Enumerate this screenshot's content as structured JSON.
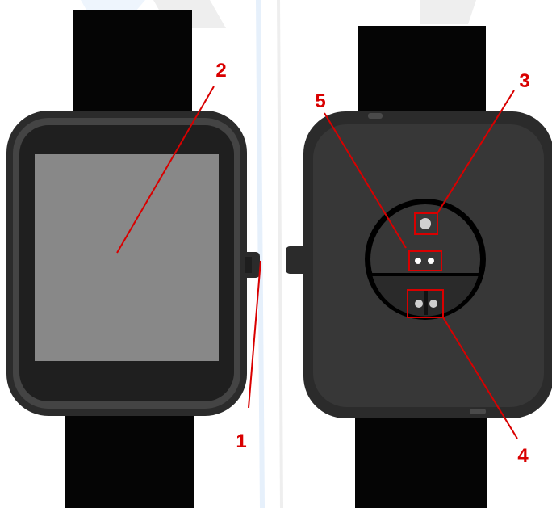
{
  "diagram": {
    "callouts": [
      {
        "id": "1",
        "label": "1"
      },
      {
        "id": "2",
        "label": "2"
      },
      {
        "id": "3",
        "label": "3"
      },
      {
        "id": "4",
        "label": "4"
      },
      {
        "id": "5",
        "label": "5"
      }
    ]
  },
  "colors": {
    "background": "#ffffff",
    "strap": "#050505",
    "case_outer": "#2b2b2b",
    "case_inner": "#444444",
    "screen": "#888888",
    "back_panel": "#373737",
    "sensor_area": "#000000",
    "sensor_light": "#d0d0d0",
    "callout": "#d90000"
  }
}
